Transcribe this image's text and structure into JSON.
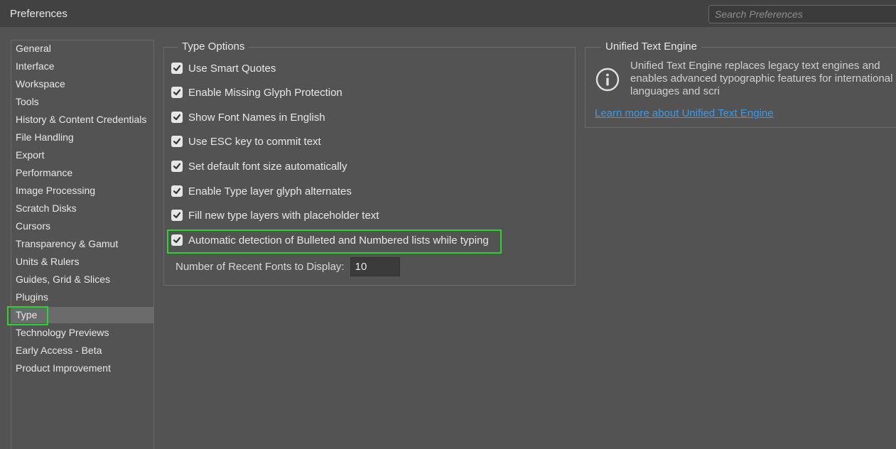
{
  "window": {
    "title": "Preferences",
    "search_placeholder": "Search Preferences"
  },
  "sidebar": {
    "selected": "Type",
    "items": [
      {
        "label": "General"
      },
      {
        "label": "Interface"
      },
      {
        "label": "Workspace"
      },
      {
        "label": "Tools"
      },
      {
        "label": "History & Content Credentials"
      },
      {
        "label": "File Handling"
      },
      {
        "label": "Export"
      },
      {
        "label": "Performance"
      },
      {
        "label": "Image Processing"
      },
      {
        "label": "Scratch Disks"
      },
      {
        "label": "Cursors"
      },
      {
        "label": "Transparency & Gamut"
      },
      {
        "label": "Units & Rulers"
      },
      {
        "label": "Guides, Grid & Slices"
      },
      {
        "label": "Plugins"
      },
      {
        "label": "Type"
      },
      {
        "label": "Technology Previews"
      },
      {
        "label": "Early Access - Beta"
      },
      {
        "label": "Product Improvement"
      }
    ]
  },
  "type_options": {
    "title": "Type Options",
    "options": [
      {
        "label": "Use Smart Quotes",
        "checked": true
      },
      {
        "label": "Enable Missing Glyph Protection",
        "checked": true
      },
      {
        "label": "Show Font Names in English",
        "checked": true
      },
      {
        "label": "Use ESC key to commit text",
        "checked": true
      },
      {
        "label": "Set default font size automatically",
        "checked": true
      },
      {
        "label": "Enable Type layer glyph alternates",
        "checked": true
      },
      {
        "label": "Fill new type layers with placeholder text",
        "checked": true
      },
      {
        "label": "Automatic detection of Bulleted and Numbered lists while typing",
        "checked": true
      }
    ],
    "recent_fonts_label": "Number of Recent Fonts to Display:",
    "recent_fonts_value": "10"
  },
  "unified_text_engine": {
    "title": "Unified Text Engine",
    "description": "Unified Text Engine replaces legacy text engines and enables advanced typographic features for international languages and scri",
    "link": "Learn more about Unified Text Engine",
    "icon": "info-icon"
  },
  "colors": {
    "background": "#535353",
    "titlebar": "#424242",
    "highlight": "#2fd32f",
    "link": "#3b9bea",
    "selected_item": "#6b6b6b"
  }
}
